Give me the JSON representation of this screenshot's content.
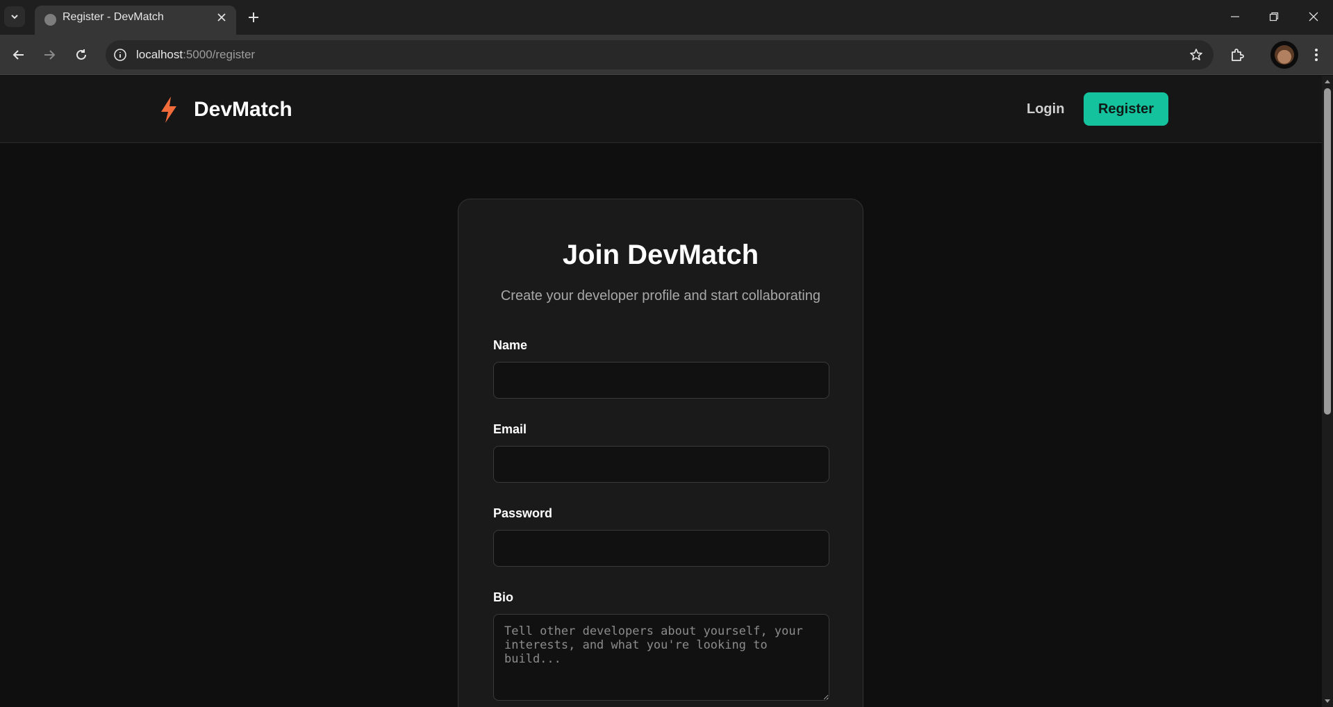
{
  "browser": {
    "tab_title": "Register - DevMatch",
    "url_host": "localhost",
    "url_path": ":5000/register"
  },
  "navbar": {
    "brand": "DevMatch",
    "login_label": "Login",
    "register_label": "Register",
    "accent_color": "#14c29d",
    "brand_icon_color": "#f26b3a"
  },
  "card": {
    "title": "Join DevMatch",
    "subtitle": "Create your developer profile and start collaborating",
    "fields": {
      "name_label": "Name",
      "name_value": "",
      "email_label": "Email",
      "email_value": "",
      "password_label": "Password",
      "password_value": "",
      "bio_label": "Bio",
      "bio_placeholder": "Tell other developers about yourself, your interests, and what you're looking to build..."
    }
  },
  "icons": {
    "tab_menu": "chevron-down-icon",
    "favicon": "globe-icon",
    "tab_close": "close-icon",
    "new_tab": "plus-icon",
    "back": "arrow-left-icon",
    "forward": "arrow-right-icon",
    "reload": "reload-icon",
    "site_info": "info-icon",
    "bookmark": "star-icon",
    "extensions": "puzzle-icon",
    "menu": "kebab-icon",
    "brand": "lightning-bolt-icon"
  }
}
